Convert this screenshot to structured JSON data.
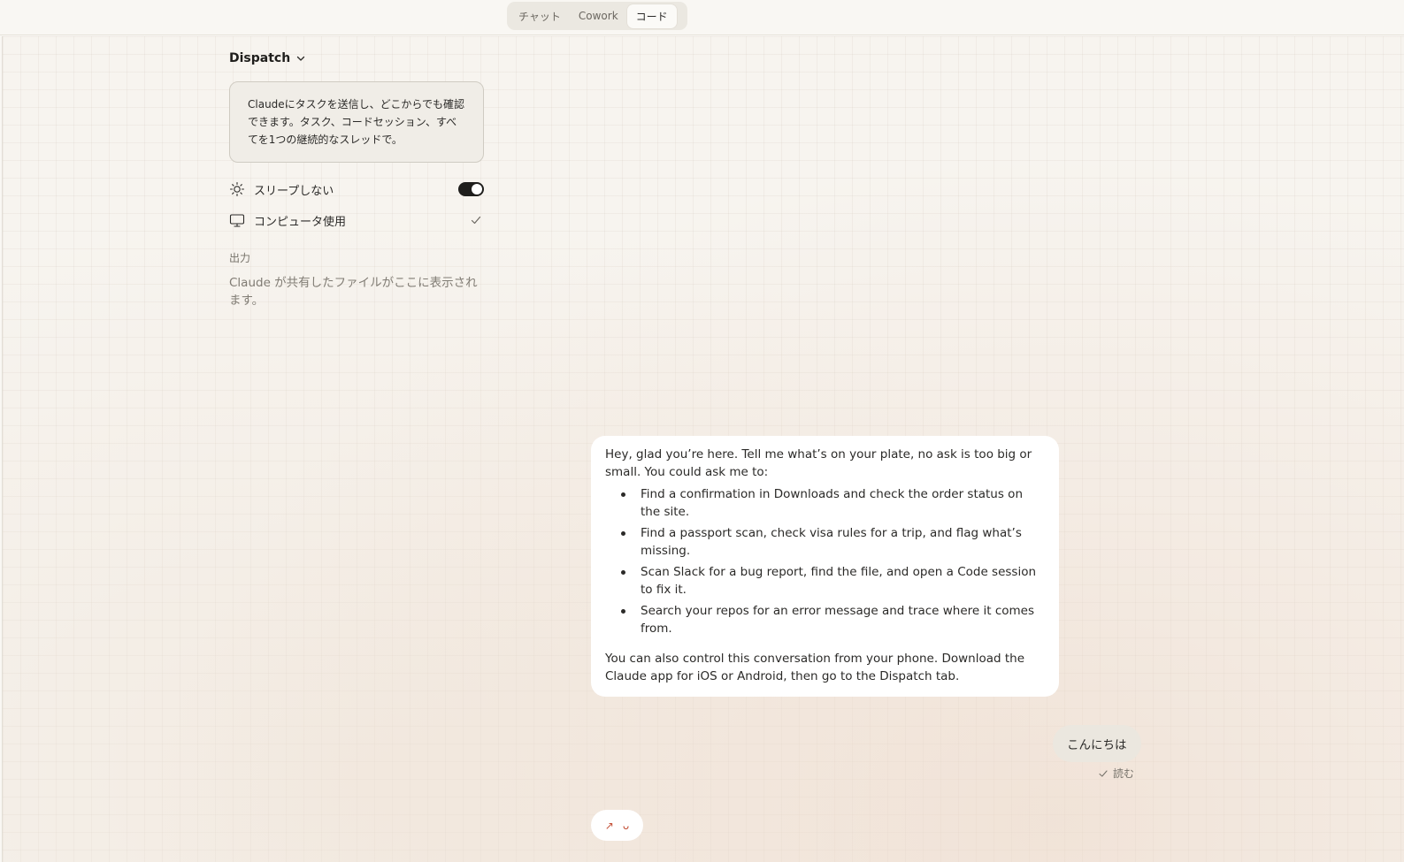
{
  "mode_tabs": [
    "チャット",
    "Cowork",
    "コード"
  ],
  "active_mode": "コード",
  "panel": {
    "title": "Dispatch",
    "info": "Claudeにタスクを送信し、どこからでも確認できます。タスク、コードセッション、すべてを1つの継続的なスレッドで。",
    "settings": [
      {
        "label": "スリープしない",
        "icon": "sun-icon",
        "control": "toggle",
        "state": "on"
      },
      {
        "label": "コンピュータ使用",
        "icon": "monitor-icon",
        "control": "checkmark",
        "state": "checked"
      }
    ],
    "output_label": "出力",
    "output_empty": "Claude が共有したファイルがここに表示されます。"
  },
  "assistant_message": {
    "intro": "Hey, glad you’re here. Tell me what’s on your plate, no ask is too big or small. You could ask me to:",
    "bullets": [
      "Find a confirmation in Downloads and check the order status on the site.",
      "Find a passport scan, check visa rules for a trip, and flag what’s missing.",
      "Scan Slack for a bug report, find the file, and open a Code session to fix it.",
      "Search your repos for an error message and trace where it comes from."
    ],
    "outro": "You can also control this conversation from your phone. Download the Claude app for iOS or Android, then go to the Dispatch tab."
  },
  "user_message": {
    "text": "こんにちは",
    "status": "読む"
  },
  "composer": {
    "glyph_left": "↗",
    "glyph_right": "ᴗ"
  },
  "colors": {
    "background": "#f7f4ef",
    "bubble": "#ffffff",
    "user_bubble": "#ebe7df",
    "toggle_on": "#1f1e1c",
    "accent": "#c4523a"
  }
}
